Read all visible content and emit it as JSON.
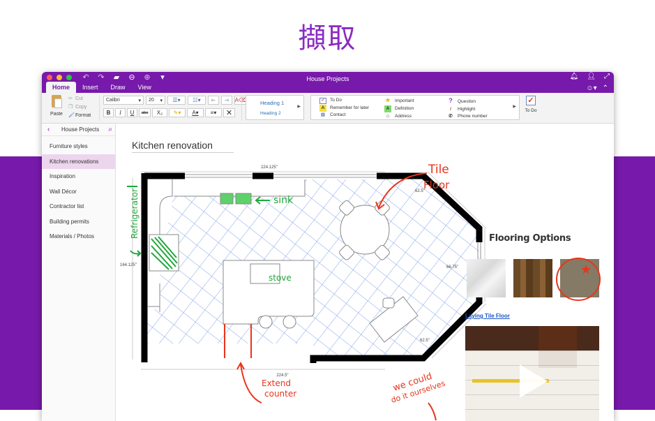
{
  "hero": {
    "title": "擷取"
  },
  "window": {
    "title": "House Projects",
    "tabs": [
      {
        "label": "Home",
        "active": true
      },
      {
        "label": "Insert",
        "active": false
      },
      {
        "label": "Draw",
        "active": false
      },
      {
        "label": "View",
        "active": false
      }
    ]
  },
  "ribbon": {
    "paste_label": "Paste",
    "cut_label": "Cut",
    "copy_label": "Copy",
    "format_label": "Format",
    "font_name": "Calibri",
    "font_size": "20",
    "bold": "B",
    "italic": "I",
    "underline": "U",
    "strike": "abc",
    "subscript": "X₂",
    "styles": {
      "heading1": "Heading 1",
      "heading2": "Heading 2"
    },
    "tags": [
      [
        {
          "icon": "✓",
          "label": "To Do",
          "color": "#d9402b"
        },
        {
          "icon": "A",
          "label": "Remember for later",
          "color": "#333"
        },
        {
          "icon": "▤",
          "label": "Contact",
          "color": "#6a8bbf"
        }
      ],
      [
        {
          "icon": "★",
          "label": "Important",
          "color": "#e8b21b"
        },
        {
          "icon": "A",
          "label": "Definition",
          "color": "#333"
        },
        {
          "icon": "⌂",
          "label": "Address",
          "color": "#6a6a6a"
        }
      ],
      [
        {
          "icon": "?",
          "label": "Question",
          "color": "#7b3fbf"
        },
        {
          "icon": "/",
          "label": "Highlight",
          "color": "#c0392b"
        },
        {
          "icon": "✆",
          "label": "Phone number",
          "color": "#333"
        }
      ]
    ],
    "todo_label": "To Do"
  },
  "sidebar": {
    "title": "House Projects",
    "items": [
      {
        "label": "Furniture styles",
        "active": false
      },
      {
        "label": "Kitchen renovations",
        "active": true
      },
      {
        "label": "Inspiration",
        "active": false
      },
      {
        "label": "Wall Décor",
        "active": false
      },
      {
        "label": "Contractor list",
        "active": false
      },
      {
        "label": "Building permits",
        "active": false
      },
      {
        "label": "Materials / Photos",
        "active": false
      }
    ]
  },
  "page": {
    "title": "Kitchen renovation",
    "dimensions": {
      "top": "224.125\"",
      "left": "164.125\"",
      "bottom": "224.5\"",
      "angle_top": "62.5\"",
      "right": "66.75\"",
      "angle_bottom": "62.5\""
    },
    "annotations": {
      "tile_floor_1": "Tile",
      "tile_floor_2": "Floor",
      "sink": "sink",
      "refrigerator": "Refrigerator",
      "stove": "stove",
      "extend_1": "Extend",
      "extend_2": "counter",
      "diy_1": "we could",
      "diy_2": "do it ourselves"
    },
    "flooring_title": "Flooring Options",
    "swatches": [
      "marble",
      "wood",
      "stone"
    ],
    "video_link": "Laying Tile Floor"
  },
  "colors": {
    "accent": "#7719aa",
    "ink_red": "#e8341c",
    "ink_green": "#1fa83a",
    "tile_blue": "#6b93e8"
  }
}
